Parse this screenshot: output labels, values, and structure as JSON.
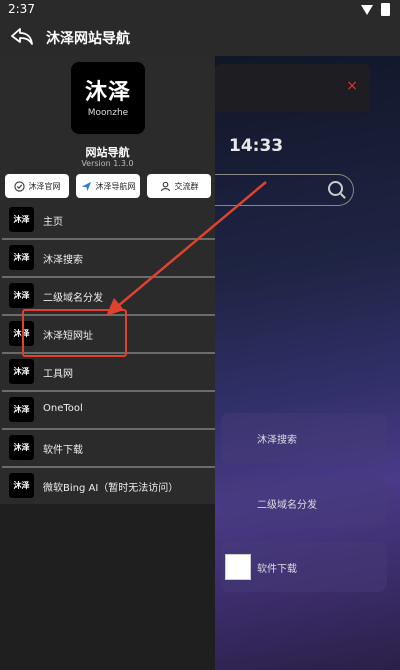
{
  "status": {
    "time": "2:37"
  },
  "titlebar": {
    "title": "沐泽网站导航"
  },
  "background": {
    "notice_close": "×",
    "clock": "14:33",
    "cards": [
      "沐泽搜索",
      "二级域名分发",
      "软件下载"
    ]
  },
  "drawer": {
    "logo_cn": "沐泽",
    "logo_en": "Moonzhe",
    "app_name": "网站导航",
    "version": "Version 1.3.0",
    "quick_buttons": [
      "沐泽官网",
      "沐泽导航网",
      "交流群"
    ],
    "menu": [
      {
        "label": "主页"
      },
      {
        "label": "沐泽搜索"
      },
      {
        "label": "二级域名分发"
      },
      {
        "label": "沐泽短网址"
      },
      {
        "label": "工具网"
      },
      {
        "label": "OneTool"
      },
      {
        "label": "软件下载"
      },
      {
        "label": "微软Bing AI（暂时无法访问）"
      }
    ],
    "menu_icon_text": "沐泽"
  },
  "colors": {
    "highlight": "#e0432d",
    "drawer": "#2b2b2b"
  }
}
